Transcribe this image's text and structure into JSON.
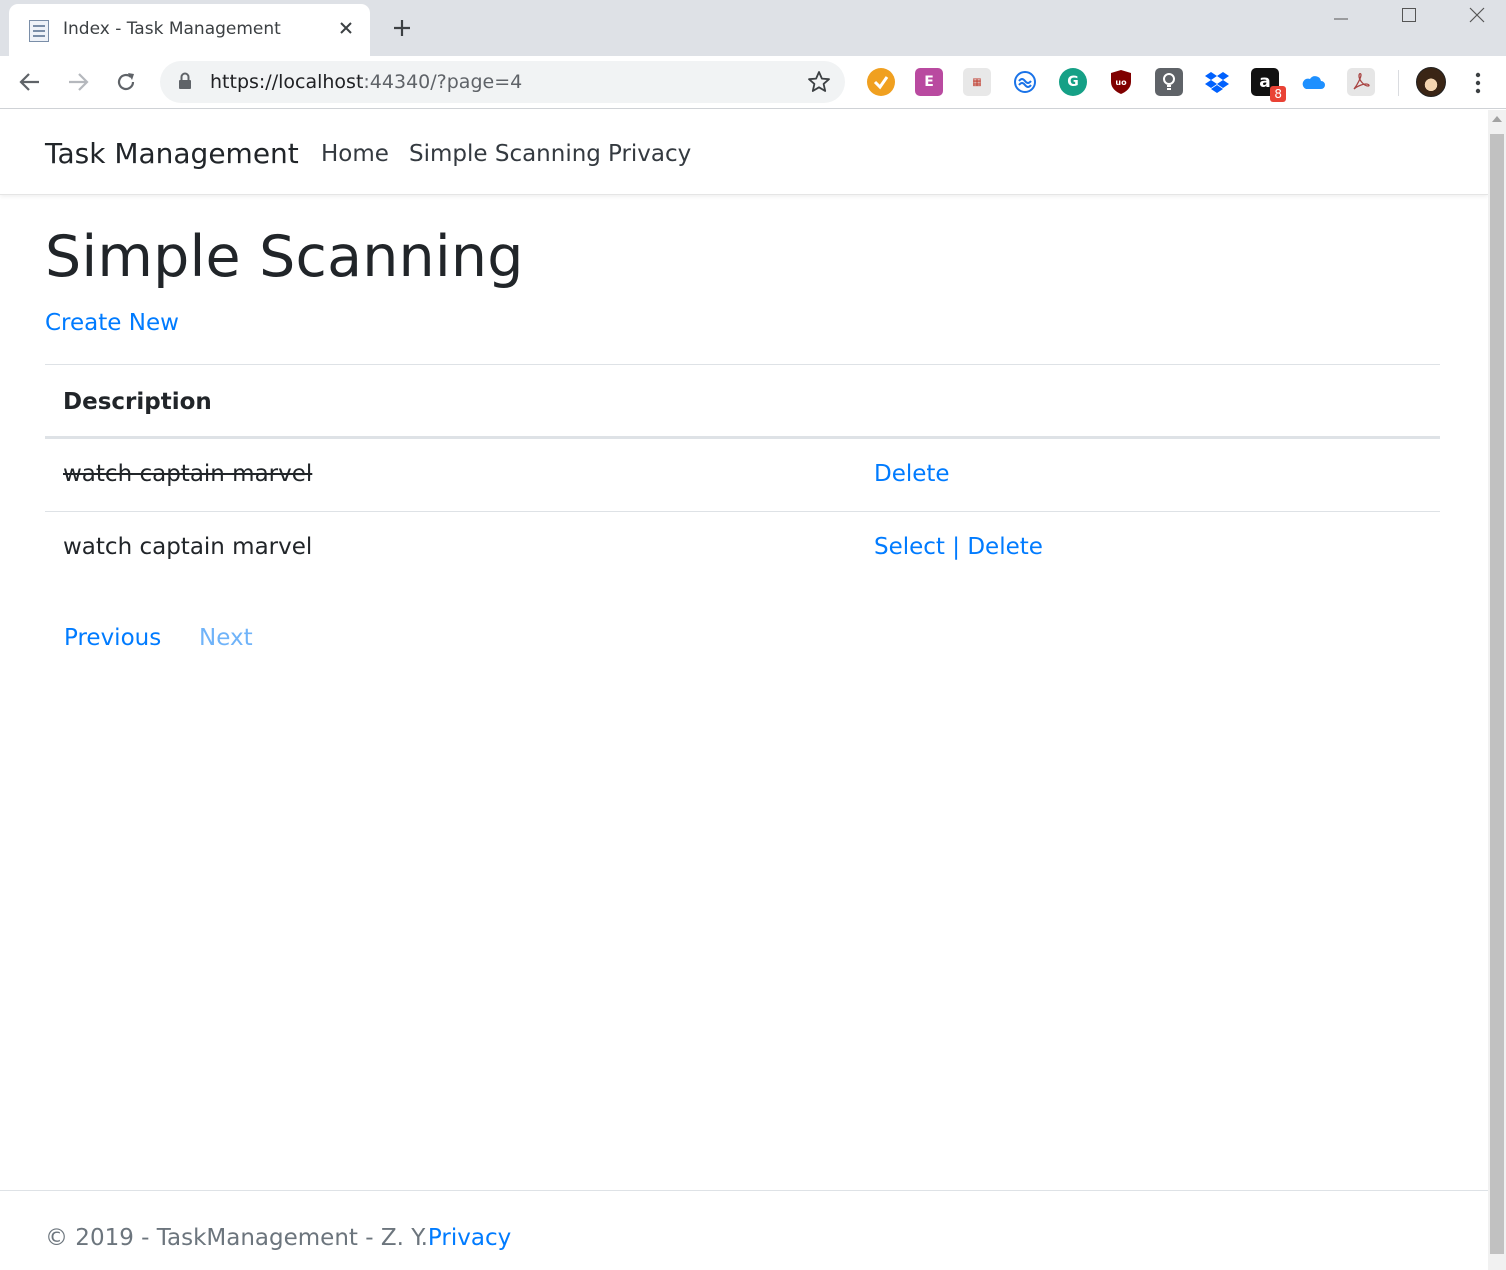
{
  "browser": {
    "tab_title": "Index - Task Management",
    "url_host": "https://localhost",
    "url_rest": ":44340/?page=4",
    "extensions": [
      {
        "name": "tampermonkey-icon",
        "color": "#f0a020"
      },
      {
        "name": "evernote-icon",
        "color": "#b94aa0"
      },
      {
        "name": "reader-icon",
        "color": "#c9c9c9"
      },
      {
        "name": "sync-icon",
        "color": "#1a73e8"
      },
      {
        "name": "grammarly-icon",
        "color": "#15a086"
      },
      {
        "name": "ublock-icon",
        "color": "#800000"
      },
      {
        "name": "lightbulb-icon",
        "color": "#5f6368"
      },
      {
        "name": "dropbox-icon",
        "color": "#0061fe"
      },
      {
        "name": "amazon-icon",
        "color": "#111111",
        "badge": "8"
      },
      {
        "name": "onedrive-icon",
        "color": "#1e90ff"
      },
      {
        "name": "acrobat-icon",
        "color": "#b0b0b0"
      }
    ]
  },
  "site": {
    "brand": "Task Management",
    "nav": [
      "Home",
      "Simple Scanning",
      "Privacy"
    ]
  },
  "main": {
    "title": "Simple Scanning",
    "create_new": "Create New",
    "table": {
      "header": "Description",
      "rows": [
        {
          "description": "watch captain marvel",
          "completed": true,
          "select": "",
          "separator": "",
          "delete": "Delete"
        },
        {
          "description": "watch captain marvel",
          "completed": false,
          "select": "Select",
          "separator": " | ",
          "delete": "Delete"
        }
      ]
    },
    "pager": {
      "previous": "Previous",
      "next": "Next"
    }
  },
  "footer": {
    "text": "© 2019 - TaskManagement - Z. Y.",
    "privacy": "Privacy"
  },
  "colors": {
    "link": "#007bff",
    "link_disabled": "#6fb3f9",
    "text": "#212529",
    "muted": "#6c757d"
  }
}
